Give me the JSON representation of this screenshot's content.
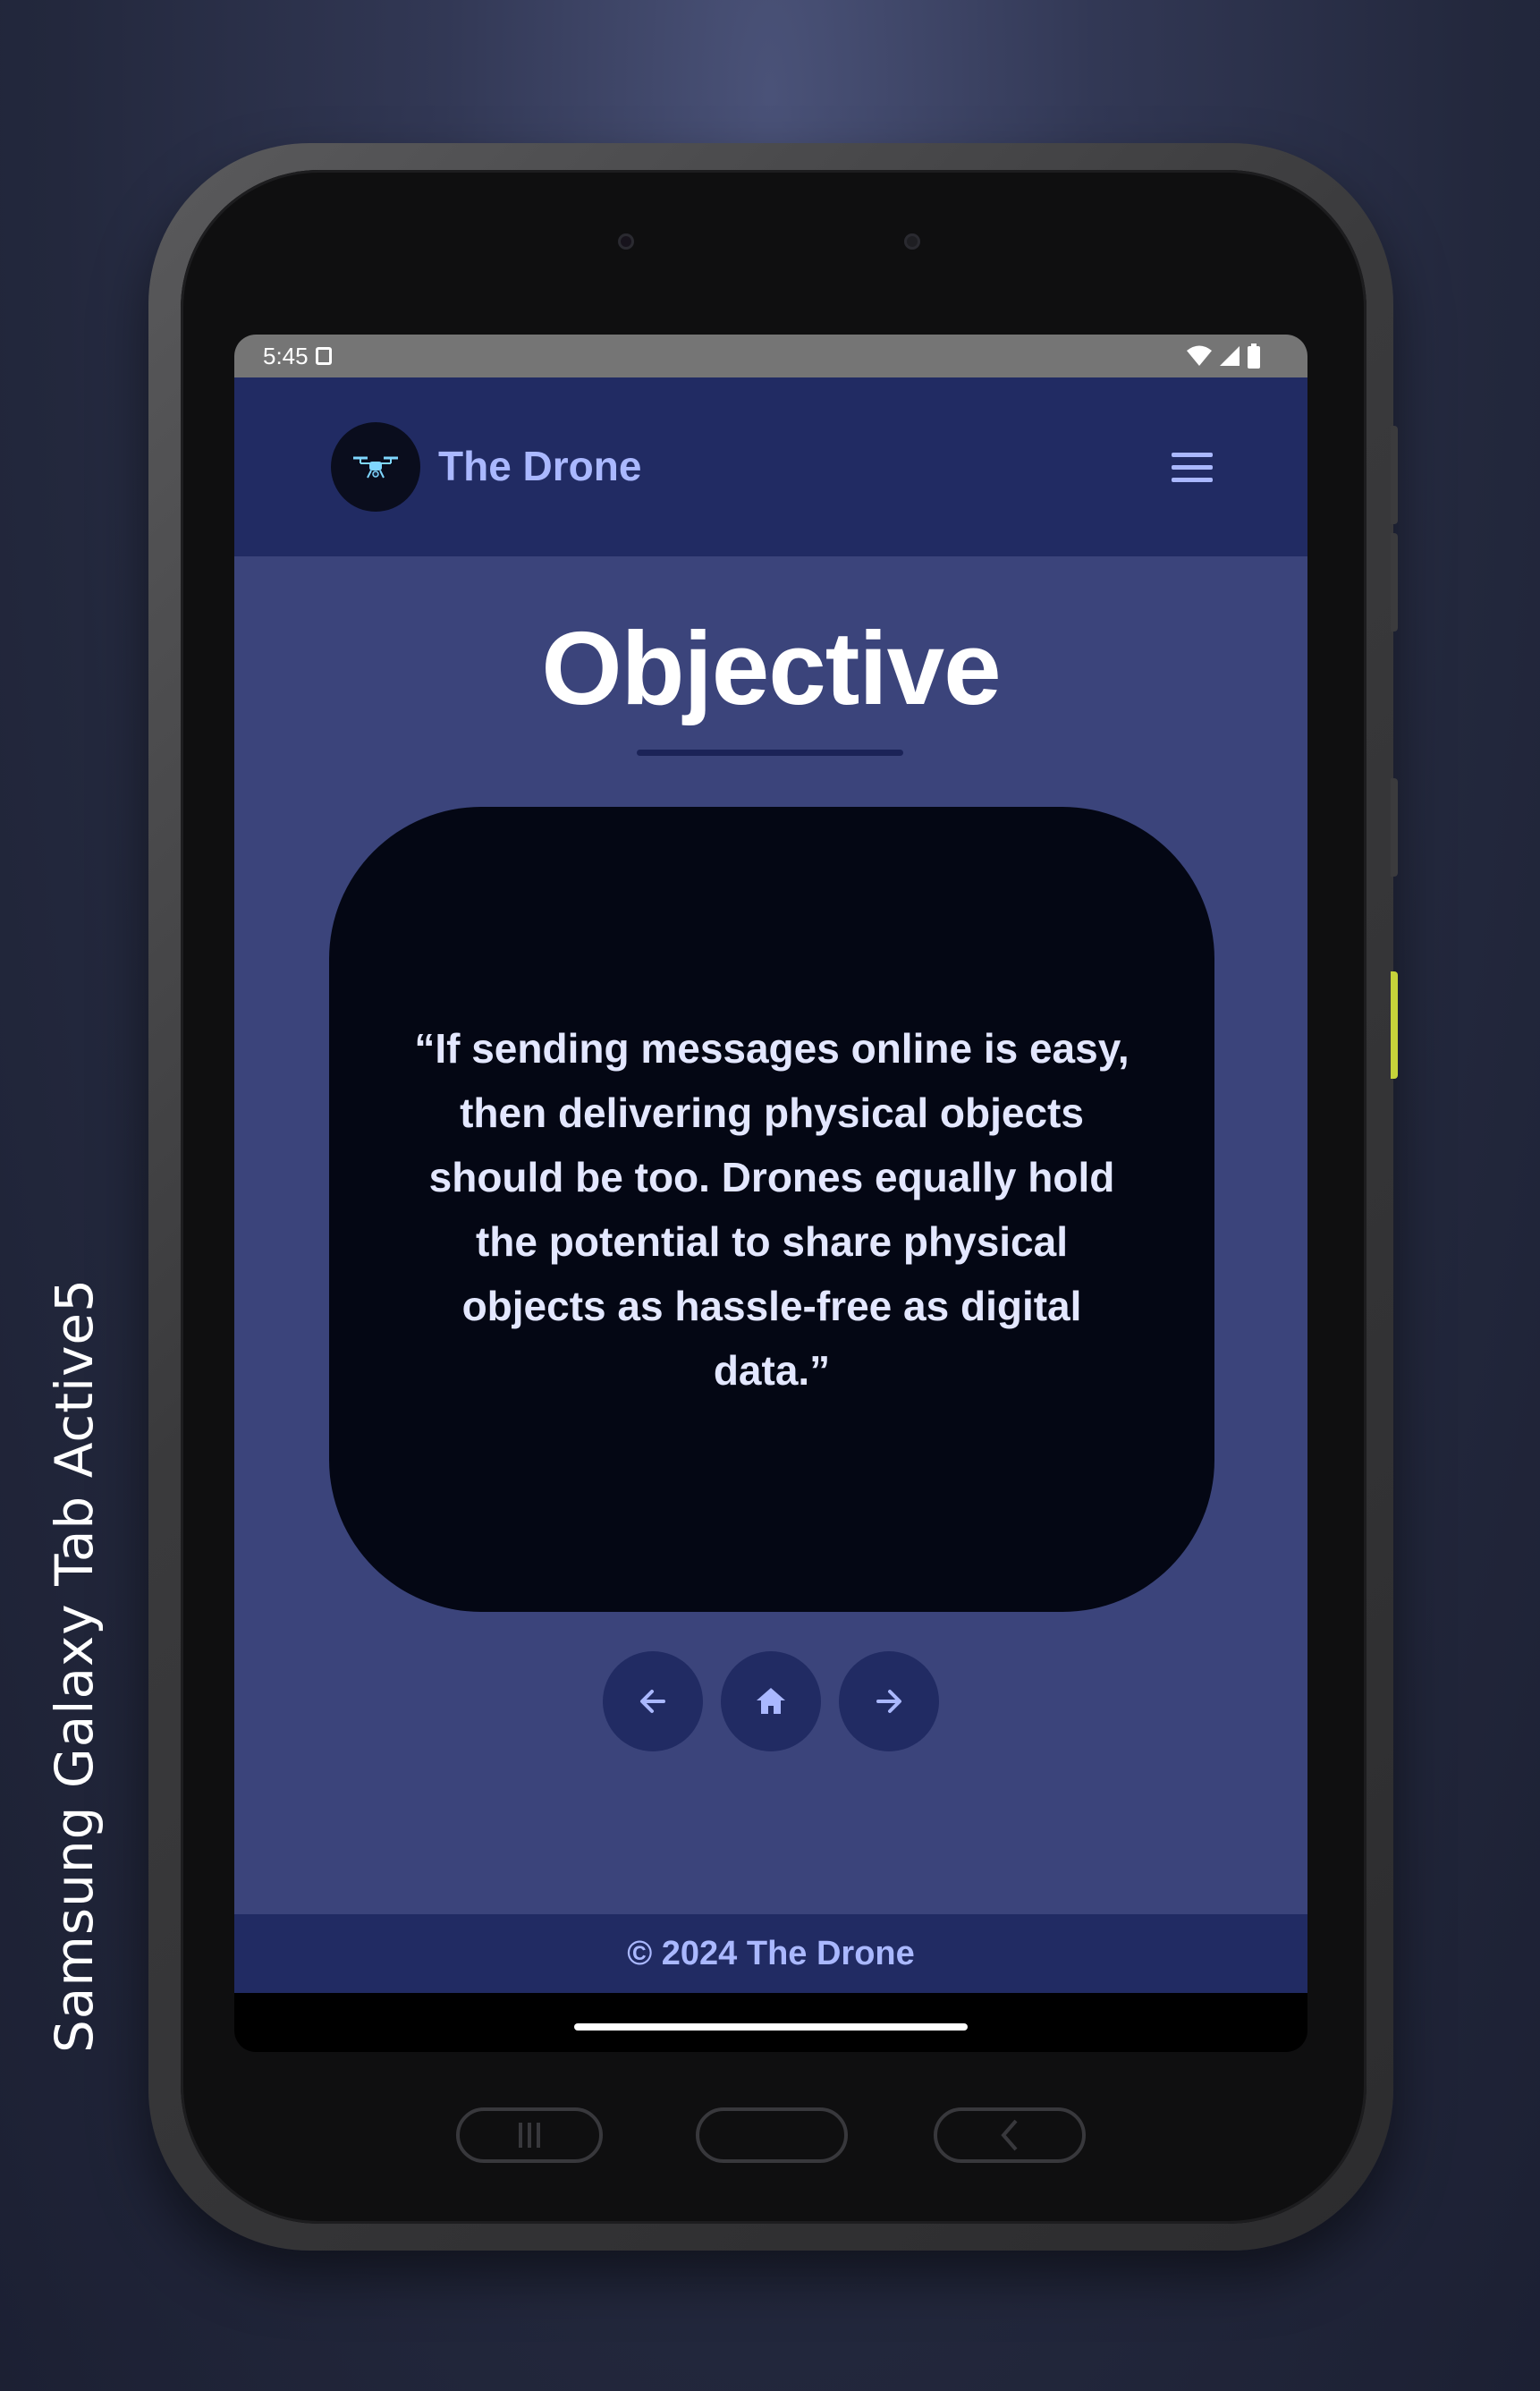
{
  "device_label": "Samsung Galaxy  Tab Active5",
  "status_bar": {
    "time": "5:45"
  },
  "header": {
    "site_title": "The Drone"
  },
  "main": {
    "page_title": "Objective",
    "quote": "“If sending messages online is easy, then delivering physical objects should be too. Drones equally hold the potential to share physical objects as hassle-free as digital data.”"
  },
  "nav": {
    "buttons": [
      {
        "icon": "arrow-left-icon"
      },
      {
        "icon": "home-icon"
      },
      {
        "icon": "arrow-right-icon"
      }
    ]
  },
  "footer": {
    "copyright": "© 2024 The Drone"
  },
  "colors": {
    "header_bg": "#212b63",
    "main_bg": "#3b447b",
    "card_bg": "#040714",
    "accent": "#aab8ff",
    "status_bar": "#757575"
  }
}
